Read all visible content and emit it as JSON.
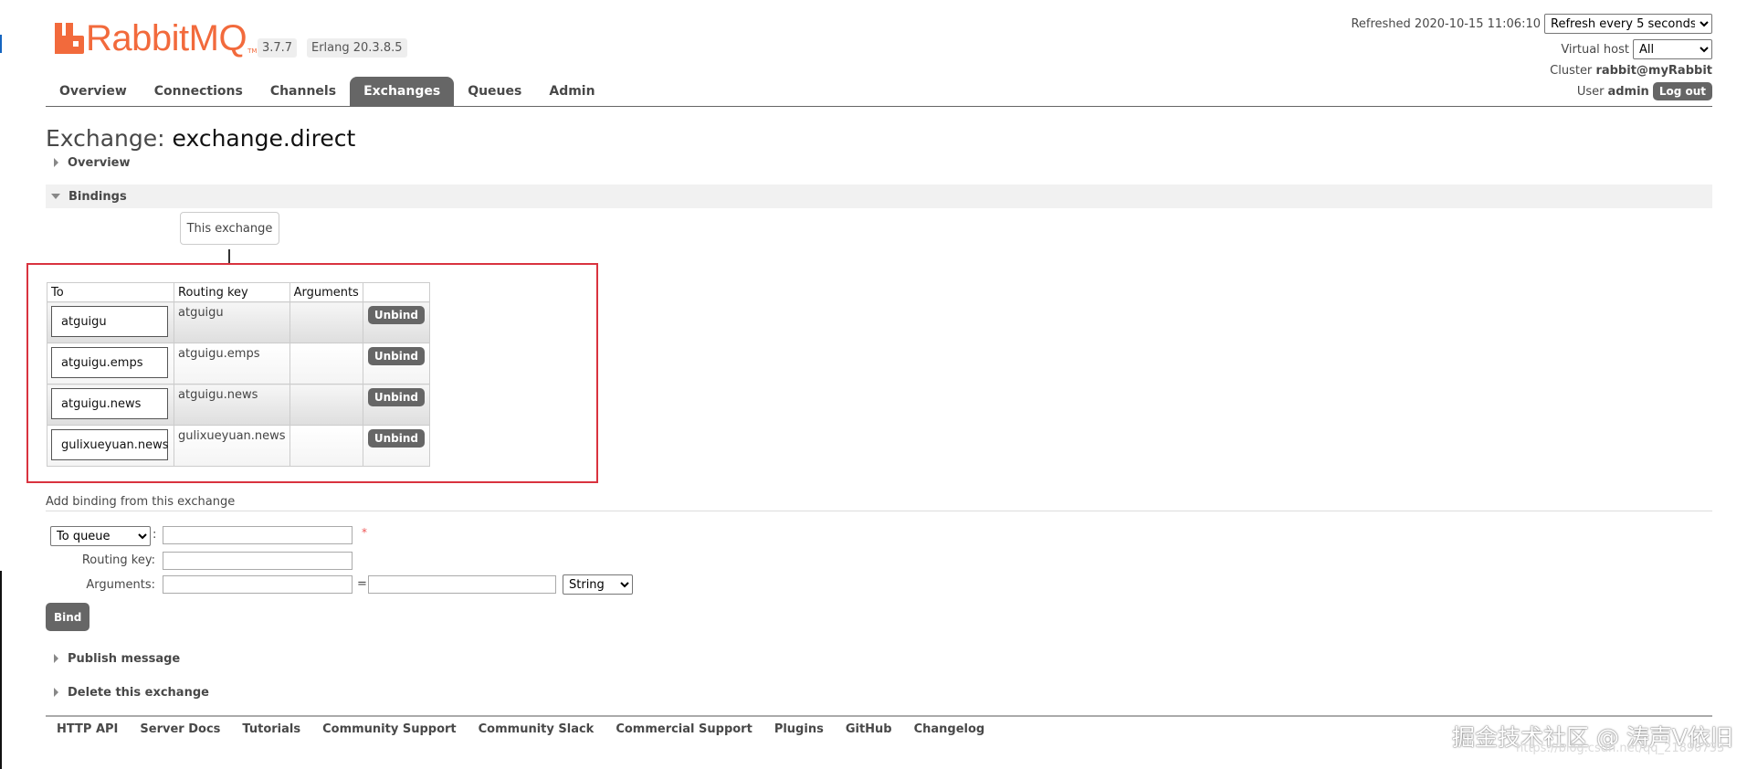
{
  "colors": {
    "brand": "#f26a3c",
    "nav_active_bg": "#666666",
    "highlight_box": "#d9333f",
    "required_star": "#e55555"
  },
  "header": {
    "logo_text": "RabbitMQ",
    "logo_tm": "TM",
    "version": "3.7.7",
    "erlang": "Erlang 20.3.8.5",
    "refreshed_label": "Refreshed 2020-10-15 11:06:10",
    "refresh_select": "Refresh every 5 seconds",
    "vhost_label": "Virtual host",
    "vhost_select": "All",
    "cluster_label": "Cluster",
    "cluster_name": "rabbit@myRabbit",
    "user_label": "User",
    "user_name": "admin",
    "logout_label": "Log out"
  },
  "nav": {
    "tabs": [
      "Overview",
      "Connections",
      "Channels",
      "Exchanges",
      "Queues",
      "Admin"
    ],
    "active": "Exchanges"
  },
  "page": {
    "title_prefix": "Exchange:",
    "title_name": "exchange.direct",
    "sections": {
      "overview": "Overview",
      "bindings": "Bindings",
      "publish": "Publish message",
      "delete": "Delete this exchange"
    },
    "this_exchange": "This exchange",
    "arrow_glyph": "⇓"
  },
  "bindings": {
    "columns": [
      "To",
      "Routing key",
      "Arguments",
      ""
    ],
    "unbind_label": "Unbind",
    "rows": [
      {
        "to": "atguigu",
        "routing_key": "atguigu",
        "arguments": ""
      },
      {
        "to": "atguigu.emps",
        "routing_key": "atguigu.emps",
        "arguments": ""
      },
      {
        "to": "atguigu.news",
        "routing_key": "atguigu.news",
        "arguments": ""
      },
      {
        "to": "gulixueyuan.news",
        "routing_key": "gulixueyuan.news",
        "arguments": ""
      }
    ]
  },
  "add_binding": {
    "title": "Add binding from this exchange",
    "destination_type": "To queue",
    "destination_value": "",
    "required_marker": "*",
    "routing_key_label": "Routing key:",
    "routing_key_value": "",
    "arguments_label": "Arguments:",
    "arg_key": "",
    "arg_eq": "=",
    "arg_value": "",
    "arg_type": "String",
    "bind_label": "Bind"
  },
  "footer": {
    "links": [
      "HTTP API",
      "Server Docs",
      "Tutorials",
      "Community Support",
      "Community Slack",
      "Commercial Support",
      "Plugins",
      "GitHub",
      "Changelog"
    ]
  },
  "watermark": {
    "line1": "掘金技术社区 @ 涛声V依旧",
    "line2": "https://blog.csdn.net/qq_21890733"
  }
}
